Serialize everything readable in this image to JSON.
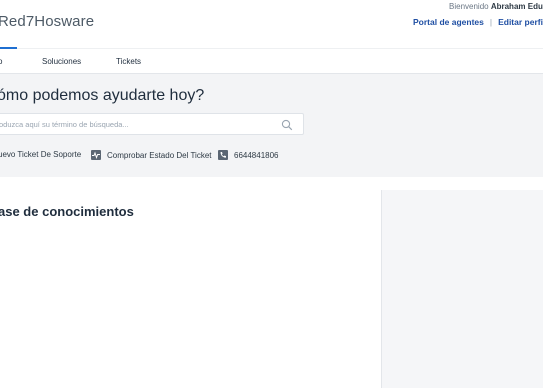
{
  "header": {
    "brand": "Red7Hosware",
    "welcome_prefix": "Bienvenido",
    "welcome_user": "Abraham Eduard",
    "links": {
      "agents_portal": "Portal de agentes",
      "edit_profile": "Editar perfil"
    },
    "separator": "|"
  },
  "nav": {
    "tabs": [
      {
        "label": "o"
      },
      {
        "label": "Soluciones"
      },
      {
        "label": "Tickets"
      }
    ]
  },
  "search": {
    "title": "ómo podemos ayudarte hoy?",
    "placeholder": "oduzca aquí su término de búsqueda..."
  },
  "quick_links": [
    {
      "label": "uevo Ticket De Soporte",
      "icon": "new-ticket-icon"
    },
    {
      "label": "Comprobar Estado Del Ticket",
      "icon": "pulse-icon"
    },
    {
      "label": "6644841806",
      "icon": "phone-icon"
    }
  ],
  "main": {
    "kb_title": "ase de conocimientos"
  },
  "colors": {
    "accent": "#1f6fd1",
    "link": "#1f4fa3",
    "band": "#f3f4f6"
  }
}
